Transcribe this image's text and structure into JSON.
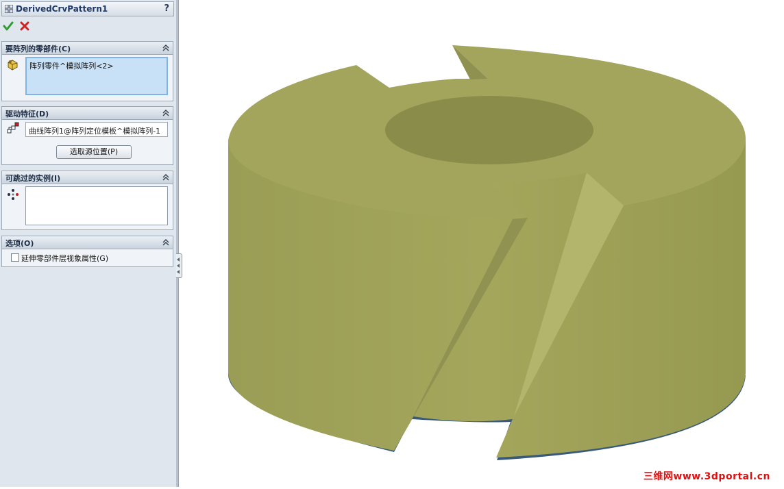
{
  "panel": {
    "title": "DerivedCrvPattern1",
    "help": "?",
    "groups": {
      "bodies": {
        "title": "要阵列的零部件(C)",
        "items": [
          "阵列零件^模拟阵列<2>"
        ]
      },
      "driving": {
        "title": "驱动特征(D)",
        "feature_value": "曲线阵列1@阵列定位模板^模拟阵列-1",
        "select_button": "选取源位置(P)"
      },
      "skip": {
        "title": "可跳过的实例(I)"
      },
      "options": {
        "title": "选项(O)",
        "checkbox_label": "延伸零部件层视象属性(G)",
        "checkbox_checked": false
      }
    }
  },
  "viewport": {
    "watermark": "三维网www.3dportal.cn",
    "model_color": "#9ea157"
  },
  "colors": {
    "accept": "#2e9b2e",
    "cancel": "#d21f1f",
    "selection_bg": "#c9e1f6"
  }
}
